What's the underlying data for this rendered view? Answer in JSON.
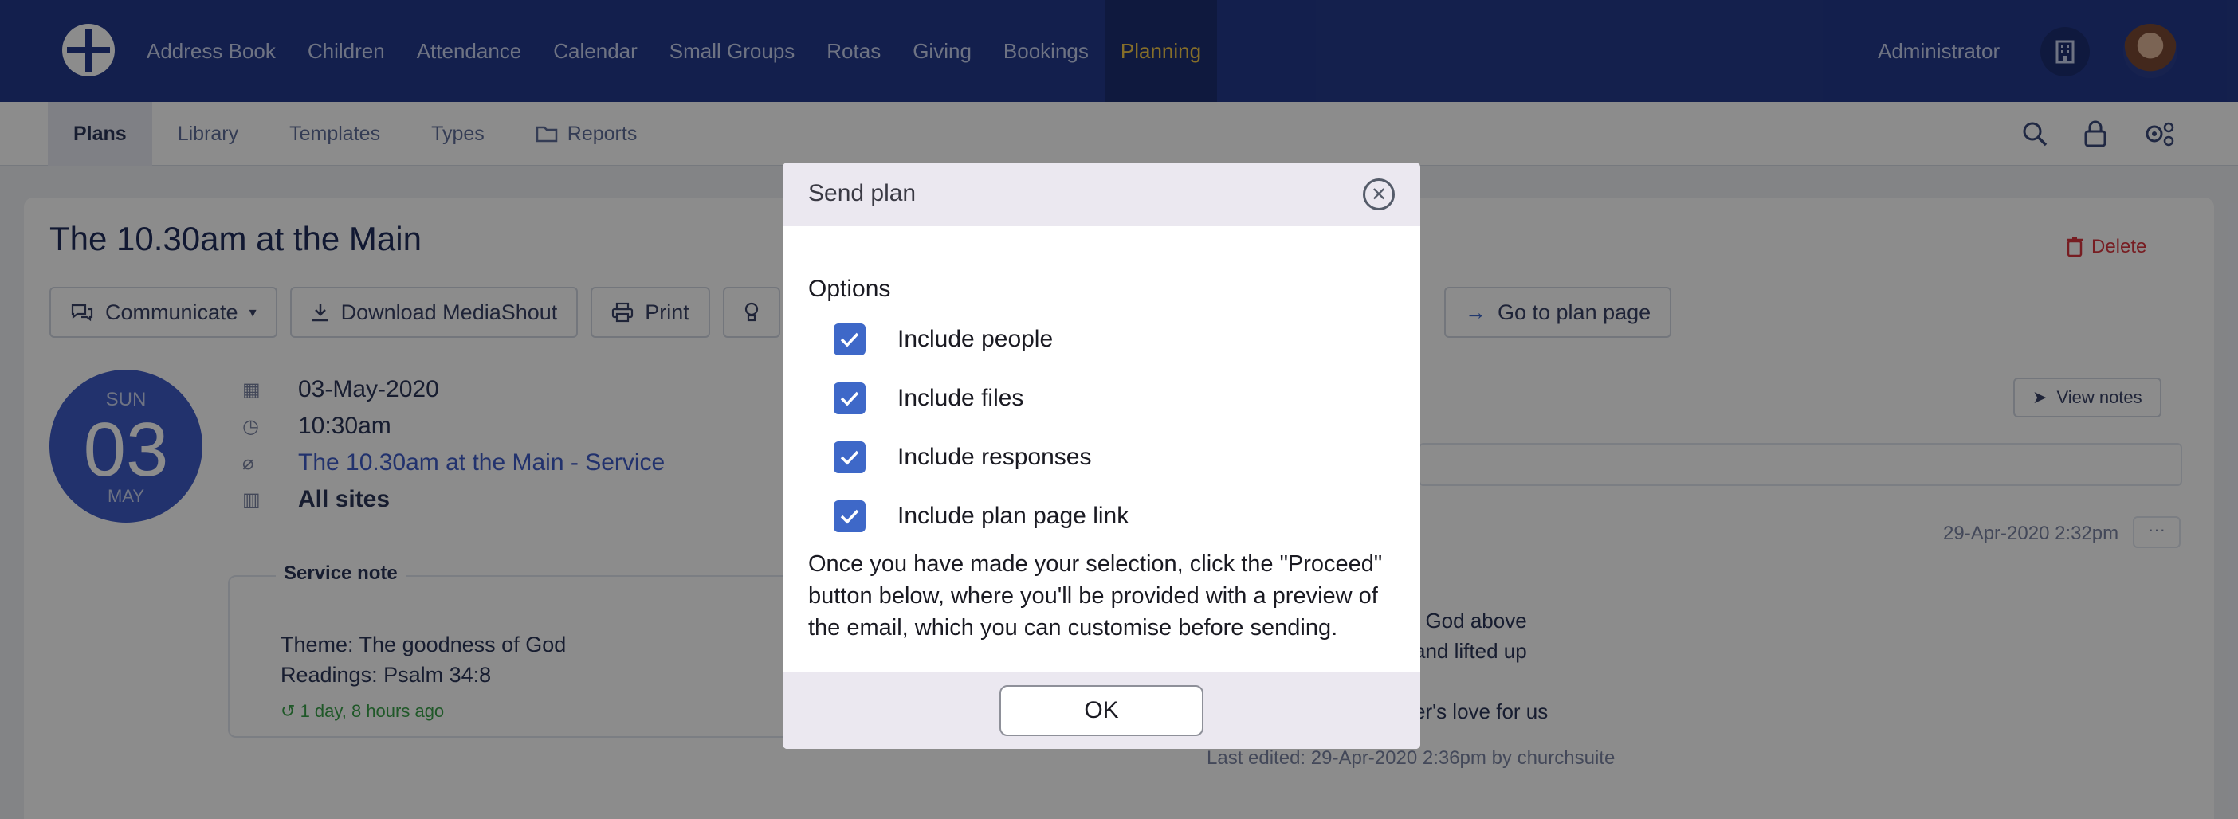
{
  "topnav": {
    "items": [
      "Address Book",
      "Children",
      "Attendance",
      "Calendar",
      "Small Groups",
      "Rotas",
      "Giving",
      "Bookings",
      "Planning"
    ],
    "active": "Planning",
    "user": "Administrator"
  },
  "subnav": {
    "items": [
      "Plans",
      "Library",
      "Templates",
      "Types",
      "Reports"
    ],
    "active": "Plans"
  },
  "plan": {
    "title": "The 10.30am at the Main",
    "delete_label": "Delete",
    "toolbar": {
      "communicate": "Communicate",
      "download": "Download MediaShout",
      "print": "Print",
      "goto": "Go to plan page"
    },
    "date_badge": {
      "dow": "SUN",
      "day": "03",
      "month": "MAY"
    },
    "date": "03-May-2020",
    "time": "10:30am",
    "service_link": "The 10.30am at the Main - Service",
    "sites": "All sites",
    "service_note": {
      "title": "Service note",
      "line1": "Theme: The goodness of God",
      "line2": "Readings: Psalm 34:8",
      "time_ago": "1 day, 8 hours ago"
    },
    "view_notes": "View notes",
    "edited_at": "29-Apr-2020 2:32pm",
    "more": "···",
    "song_line1": "f God above",
    "song_line2": "and lifted up",
    "song_line3": "er's love for us",
    "last_edited": "Last edited: 29-Apr-2020 2:36pm by churchsuite"
  },
  "modal": {
    "title": "Send plan",
    "options_label": "Options",
    "options": [
      {
        "label": "Include people",
        "checked": true
      },
      {
        "label": "Include files",
        "checked": true
      },
      {
        "label": "Include responses",
        "checked": true
      },
      {
        "label": "Include plan page link",
        "checked": true
      }
    ],
    "description": "Once you have made your selection, click the \"Proceed\" button below, where you'll be provided with a preview of the email, which you can customise before sending.",
    "ok_label": "OK"
  },
  "colors": {
    "navbar": "#243a8c",
    "accent": "#3e68c8",
    "active_nav": "#f2c94c",
    "danger": "#d9363e"
  }
}
